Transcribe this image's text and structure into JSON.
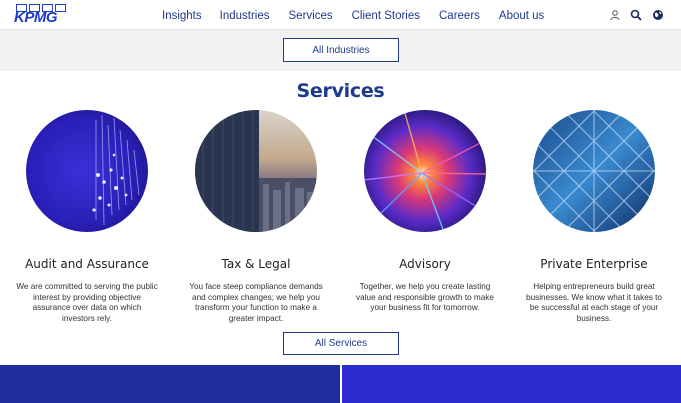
{
  "header": {
    "logo_text": "KPMG",
    "nav": [
      "Insights",
      "Industries",
      "Services",
      "Client Stories",
      "Careers",
      "About us"
    ],
    "icons": [
      "user-icon",
      "search-icon",
      "globe-icon"
    ]
  },
  "filter": {
    "industries_button": "All Industries"
  },
  "section": {
    "title": "Services"
  },
  "cards": [
    {
      "title": "Audit and Assurance",
      "description": "We are committed to serving the public interest by providing objective assurance over data on which investors rely."
    },
    {
      "title": "Tax & Legal",
      "description": "You face steep compliance demands and complex changes; we help you transform your function to make a greater impact."
    },
    {
      "title": "Advisory",
      "description": "Together, we help you create lasting value and responsible growth to make your business fit for tomorrow."
    },
    {
      "title": "Private Enterprise",
      "description": "Helping entrepreneurs build great businesses. We know what it takes to be successful at each stage of your business."
    }
  ],
  "services_button": "All Services",
  "colors": {
    "brand_blue": "#1e3a8a",
    "logo_blue": "#1e3cc8",
    "footer_left": "#1e2f9c",
    "footer_right": "#2d2bd0"
  }
}
